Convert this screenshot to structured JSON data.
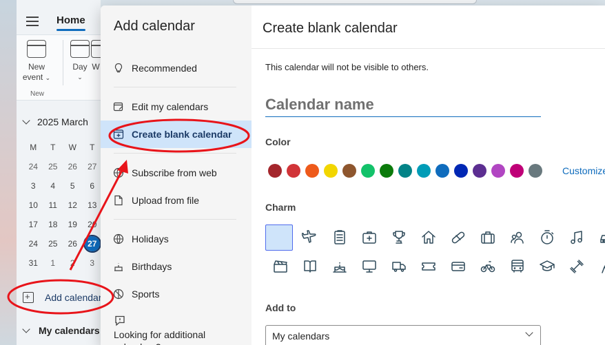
{
  "app": {
    "home_tab": "Home",
    "ribbon": {
      "new_event_line1": "New",
      "new_event_line2": "event",
      "day_label": "Day",
      "group_label": "New"
    },
    "mini_calendar": {
      "month_label": "2025 March",
      "weekday_headers": [
        "M",
        "T",
        "W",
        "T"
      ],
      "weeks": [
        [
          "24",
          "25",
          "26",
          "27"
        ],
        [
          "3",
          "4",
          "5",
          "6"
        ],
        [
          "10",
          "11",
          "12",
          "13"
        ],
        [
          "17",
          "18",
          "19",
          "20"
        ],
        [
          "24",
          "25",
          "26",
          "27"
        ],
        [
          "31",
          "1",
          "2",
          "3"
        ]
      ],
      "today": "27"
    },
    "add_calendar_label": "Add calendar",
    "my_calendars_label": "My calendars"
  },
  "dialog": {
    "nav_title": "Add calendar",
    "nav_items": [
      {
        "label": "Recommended",
        "icon": "lightbulb-icon"
      },
      {
        "label": "Edit my calendars",
        "icon": "edit-calendar-icon"
      },
      {
        "label": "Create blank calendar",
        "icon": "calendar-add-icon",
        "selected": true
      },
      {
        "label": "Subscribe from web",
        "icon": "globe-icon"
      },
      {
        "label": "Upload from file",
        "icon": "document-icon"
      },
      {
        "label": "Holidays",
        "icon": "globe-icon"
      },
      {
        "label": "Birthdays",
        "icon": "cake-icon"
      },
      {
        "label": "Sports",
        "icon": "sports-ball-icon"
      }
    ],
    "nav_footer": "Looking for additional calendars?",
    "content": {
      "title": "Create blank calendar",
      "note": "This calendar will not be visible to others.",
      "name_placeholder": "Calendar name",
      "name_value": "",
      "color_label": "Color",
      "colors": [
        "#a4262c",
        "#d13438",
        "#ee5a1b",
        "#f2d600",
        "#8e562e",
        "#13c26a",
        "#0b7a0b",
        "#038387",
        "#009cb7",
        "#0f6cbd",
        "#0027b4",
        "#5c2e91",
        "#b146c2",
        "#bf0077",
        "#69797e"
      ],
      "customize_label": "Customize",
      "charm_label": "Charm",
      "charms_row1": [
        "blank",
        "airplane-icon",
        "clipboard-icon",
        "medical-bag-icon",
        "trophy-icon",
        "home-icon",
        "pill-icon",
        "briefcase-icon",
        "people-icon",
        "timer-icon",
        "music-icon",
        "car-icon"
      ],
      "charms_row2": [
        "clapperboard-icon",
        "book-icon",
        "cake-icon",
        "monitor-icon",
        "truck-icon",
        "ticket-icon",
        "credit-card-icon",
        "cyclist-icon",
        "bus-icon",
        "graduation-cap-icon",
        "dumbbell-icon",
        "hiker-icon"
      ],
      "add_to_label": "Add to",
      "add_to_value": "My calendars"
    }
  },
  "annotation_color": "#e8141a"
}
